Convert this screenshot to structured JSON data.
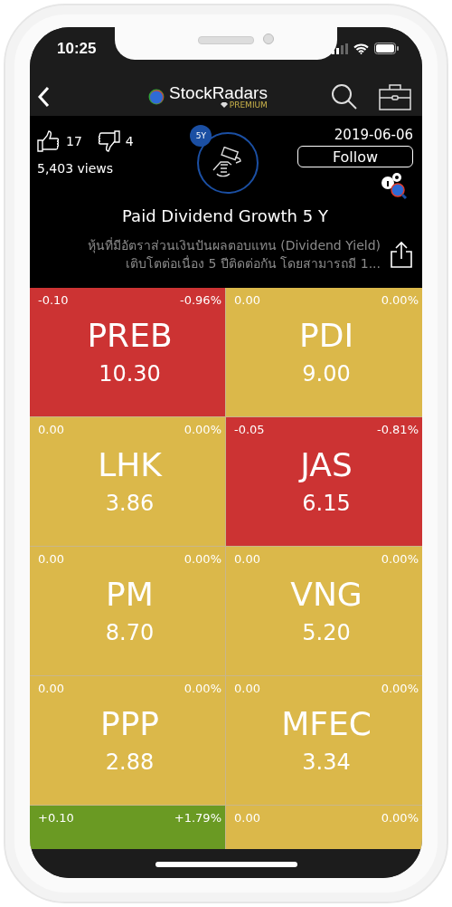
{
  "status_bar": {
    "time": "10:25"
  },
  "nav": {
    "brand": "StockRadars",
    "badge": "PREMIUM"
  },
  "screener": {
    "likes": "17",
    "dislikes": "4",
    "views": "5,403 views",
    "period_badge": "5Y",
    "date": "2019-06-06",
    "follow_button": "Follow",
    "title": "Paid Dividend Growth 5 Y",
    "description": "หุ้นที่มีอัตราส่วนเงินปันผลตอบแทน (Dividend Yield) เติบโตต่อเนื่อง 5 ปีติดต่อกัน โดยสามารถมี 1..."
  },
  "tiles": [
    {
      "color": "#cc3333",
      "change": "-0.10",
      "change_pct": "-0.96%",
      "symbol": "PREB",
      "price": "10.30"
    },
    {
      "color": "#dbb84a",
      "change": "0.00",
      "change_pct": "0.00%",
      "symbol": "PDI",
      "price": "9.00"
    },
    {
      "color": "#dbb84a",
      "change": "0.00",
      "change_pct": "0.00%",
      "symbol": "LHK",
      "price": "3.86"
    },
    {
      "color": "#cc3333",
      "change": "-0.05",
      "change_pct": "-0.81%",
      "symbol": "JAS",
      "price": "6.15"
    },
    {
      "color": "#dbb84a",
      "change": "0.00",
      "change_pct": "0.00%",
      "symbol": "PM",
      "price": "8.70"
    },
    {
      "color": "#dbb84a",
      "change": "0.00",
      "change_pct": "0.00%",
      "symbol": "VNG",
      "price": "5.20"
    },
    {
      "color": "#dbb84a",
      "change": "0.00",
      "change_pct": "0.00%",
      "symbol": "PPP",
      "price": "2.88"
    },
    {
      "color": "#dbb84a",
      "change": "0.00",
      "change_pct": "0.00%",
      "symbol": "MFEC",
      "price": "3.34"
    },
    {
      "color": "#6a9a23",
      "change": "+0.10",
      "change_pct": "+1.79%"
    },
    {
      "color": "#dbb84a",
      "change": "0.00",
      "change_pct": "0.00%"
    }
  ]
}
